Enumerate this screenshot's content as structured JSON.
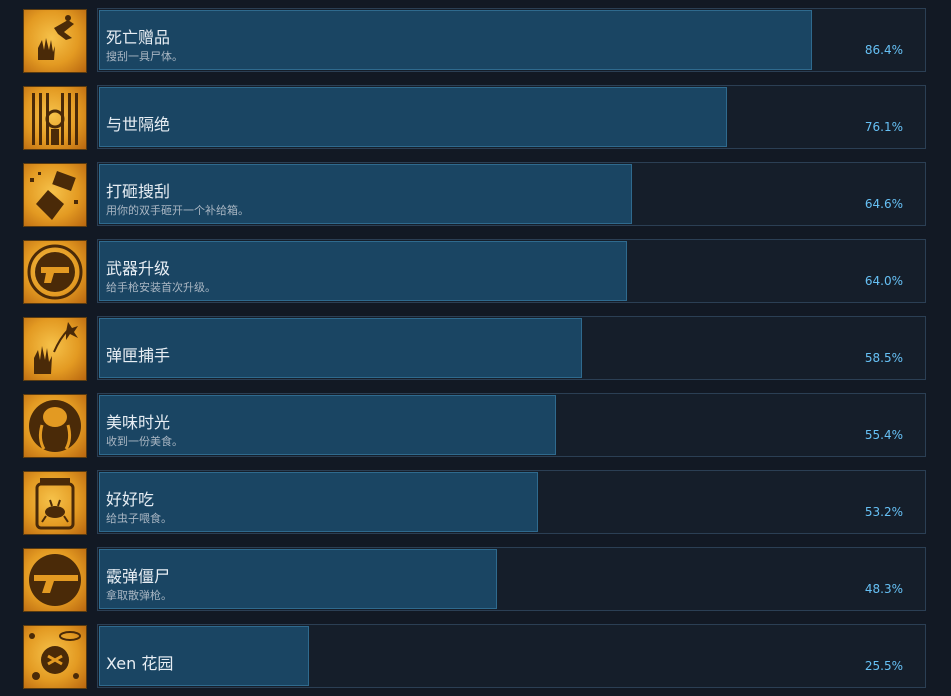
{
  "achievements": [
    {
      "title": "死亡赠品",
      "description": "搜刮一具尸体。",
      "percent_label": "86.4%",
      "percent": 86.4,
      "icon": "hand-body-icon"
    },
    {
      "title": "与世隔绝",
      "description": "",
      "percent_label": "76.1%",
      "percent": 76.1,
      "icon": "gate-icon"
    },
    {
      "title": "打砸搜刮",
      "description": "用你的双手砸开一个补给箱。",
      "percent_label": "64.6%",
      "percent": 64.6,
      "icon": "smash-crate-icon"
    },
    {
      "title": "武器升级",
      "description": "给手枪安装首次升级。",
      "percent_label": "64.0%",
      "percent": 64.0,
      "icon": "pistol-icon"
    },
    {
      "title": "弹匣捕手",
      "description": "",
      "percent_label": "58.5%",
      "percent": 58.5,
      "icon": "catch-magazine-icon"
    },
    {
      "title": "美味时光",
      "description": "收到一份美食。",
      "percent_label": "55.4%",
      "percent": 55.4,
      "icon": "headcrab-icon"
    },
    {
      "title": "好好吃",
      "description": "给虫子喂食。",
      "percent_label": "53.2%",
      "percent": 53.2,
      "icon": "bug-jar-icon"
    },
    {
      "title": "霰弹僵尸",
      "description": "拿取散弹枪。",
      "percent_label": "48.3%",
      "percent": 48.3,
      "icon": "shotgun-icon"
    },
    {
      "title": "Xen 花园",
      "description": "",
      "percent_label": "25.5%",
      "percent": 25.5,
      "icon": "xen-plant-icon"
    }
  ],
  "colors": {
    "background": "#121924",
    "bar_fill": "#1a4563",
    "percent_text": "#66c0f4",
    "icon_gold": "#e39a22"
  }
}
